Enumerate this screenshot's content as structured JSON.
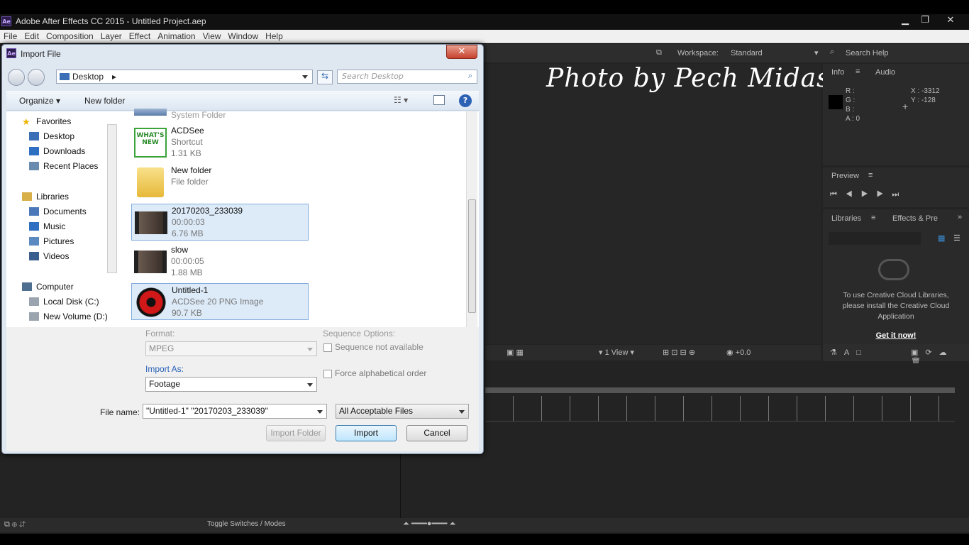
{
  "app": {
    "title": "Adobe After Effects CC 2015 - Untitled Project.aep",
    "icon_text": "Ae",
    "window_controls": [
      "minimize-icon",
      "restore-icon",
      "close-icon"
    ]
  },
  "menu": [
    "File",
    "Edit",
    "Composition",
    "Layer",
    "Effect",
    "Animation",
    "View",
    "Window",
    "Help"
  ],
  "toolbar": {
    "workspace_label": "Workspace:",
    "workspace_value": "Standard",
    "search_help": "Search Help"
  },
  "watermark": "Photo by Pech Midas",
  "info_panel": {
    "tabs": [
      "Info",
      "Audio"
    ],
    "channels": [
      "R :",
      "G :",
      "B :",
      "A : 0"
    ],
    "coords": [
      "X : -3312",
      "Y : -128"
    ]
  },
  "preview_panel": {
    "title": "Preview"
  },
  "libraries_panel": {
    "tabs": [
      "Libraries",
      "Effects & Pre"
    ],
    "message": "To use Creative Cloud Libraries, please install the Creative Cloud Application",
    "link": "Get it now!"
  },
  "comp_bar": {
    "view": "1 View",
    "exposure": "+0.0"
  },
  "bottom_bar": {
    "toggle": "Toggle Switches / Modes"
  },
  "dialog": {
    "title": "Import File",
    "icon_text": "Ae",
    "close": "✕",
    "location": "Desktop",
    "search_placeholder": "Search Desktop",
    "organize": "Organize",
    "new_folder": "New folder",
    "nav": [
      {
        "label": "Favorites",
        "icon": "star-icon",
        "indent": 0
      },
      {
        "label": "Desktop",
        "icon": "desktop-icon",
        "indent": 1
      },
      {
        "label": "Downloads",
        "icon": "downloads-icon",
        "indent": 1
      },
      {
        "label": "Recent Places",
        "icon": "recent-places-icon",
        "indent": 1
      },
      {
        "label": "Libraries",
        "icon": "libraries-icon",
        "indent": 0
      },
      {
        "label": "Documents",
        "icon": "documents-icon",
        "indent": 1
      },
      {
        "label": "Music",
        "icon": "music-icon",
        "indent": 1
      },
      {
        "label": "Pictures",
        "icon": "pictures-icon",
        "indent": 1
      },
      {
        "label": "Videos",
        "icon": "videos-icon",
        "indent": 1
      },
      {
        "label": "Computer",
        "icon": "computer-icon",
        "indent": 0
      },
      {
        "label": "Local Disk (C:)",
        "icon": "drive-icon",
        "indent": 1
      },
      {
        "label": "New Volume (D:)",
        "icon": "drive-icon",
        "indent": 1
      }
    ],
    "files": [
      {
        "name": "System Folder",
        "l2": "",
        "l3": "",
        "selected": false,
        "icon": "system-folder-icon"
      },
      {
        "name": "ACDSee",
        "l2": "Shortcut",
        "l3": "1.31 KB",
        "selected": false,
        "icon": "acdsee-icon"
      },
      {
        "name": "New folder",
        "l2": "File folder",
        "l3": "",
        "selected": false,
        "icon": "folder-icon"
      },
      {
        "name": "20170203_233039",
        "l2": "00:00:03",
        "l3": "6.76 MB",
        "selected": true,
        "icon": "video-thumbnail-icon"
      },
      {
        "name": "slow",
        "l2": "00:00:05",
        "l3": "1.88 MB",
        "selected": false,
        "icon": "video-thumbnail-icon"
      },
      {
        "name": "Untitled-1",
        "l2": "ACDSee 20 PNG Image",
        "l3": "90.7 KB",
        "selected": true,
        "icon": "png-image-icon"
      }
    ],
    "format_label": "Format:",
    "format_value": "MPEG",
    "sequence_label": "Sequence Options:",
    "sequence_value": "Sequence not available",
    "force_alpha": "Force alphabetical order",
    "import_as_label": "Import As:",
    "import_as_value": "Footage",
    "filename_label": "File name:",
    "filename_value": "\"Untitled-1\" \"20170203_233039\"",
    "filetype_value": "All Acceptable Files",
    "import_folder": "Import Folder",
    "import": "Import",
    "cancel": "Cancel"
  },
  "colors": {
    "accent": "#84acdd",
    "link": "#ffffff",
    "ae_purple": "#2b1d4a"
  }
}
